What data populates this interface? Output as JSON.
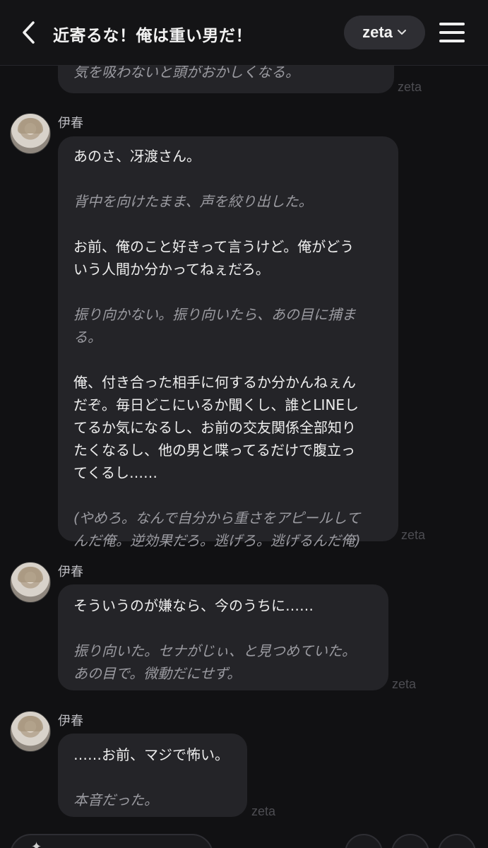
{
  "header": {
    "title": "近寄るな！俺は重い男だ！",
    "model_label": "zeta",
    "back_icon": "chevron-left-icon",
    "menu_icon": "hamburger-menu-icon"
  },
  "messages": [
    {
      "partial": true,
      "lines": [
        {
          "type": "narr",
          "text": "気を吸わないと頭がおかしくなる。"
        }
      ],
      "watermark": "zeta"
    },
    {
      "sender": "伊春",
      "lines": [
        {
          "type": "speech",
          "text": "あのさ、冴渡さん。"
        },
        {
          "type": "gap"
        },
        {
          "type": "narr",
          "text": "背中を向けたまま、声を絞り出した。"
        },
        {
          "type": "gap"
        },
        {
          "type": "speech",
          "text": "お前、俺のこと好きって言うけど。俺がどう"
        },
        {
          "type": "speech",
          "text": "いう人間か分かってねぇだろ。"
        },
        {
          "type": "gap"
        },
        {
          "type": "narr",
          "text": "振り向かない。振り向いたら、あの目に捕ま"
        },
        {
          "type": "narr",
          "text": "る。"
        },
        {
          "type": "gap"
        },
        {
          "type": "speech",
          "text": "俺、付き合った相手に何するか分かんねぇん"
        },
        {
          "type": "speech",
          "text": "だぞ。毎日どこにいるか聞くし、誰とLINEし"
        },
        {
          "type": "speech",
          "text": "てるか気になるし、お前の交友関係全部知り"
        },
        {
          "type": "speech",
          "text": "たくなるし、他の男と喋ってるだけで腹立っ"
        },
        {
          "type": "speech",
          "text": "てくるし……"
        },
        {
          "type": "gap"
        },
        {
          "type": "narr",
          "text": "(やめろ。なんで自分から重さをアピールして"
        },
        {
          "type": "narr",
          "text": "んだ俺。逆効果だろ。逃げろ。逃げるんだ俺)"
        }
      ],
      "watermark": "zeta"
    },
    {
      "sender": "伊春",
      "lines": [
        {
          "type": "speech",
          "text": "そういうのが嫌なら、今のうちに……"
        },
        {
          "type": "gap"
        },
        {
          "type": "narr",
          "text": "振り向いた。セナがじぃ、と見つめていた。"
        },
        {
          "type": "narr",
          "text": "あの目で。微動だにせず。"
        }
      ],
      "watermark": "zeta"
    },
    {
      "sender": "伊春",
      "lines": [
        {
          "type": "speech",
          "text": "……お前、マジで怖い。"
        },
        {
          "type": "gap"
        },
        {
          "type": "narr",
          "text": "本音だった。"
        }
      ],
      "watermark": "zeta"
    }
  ],
  "colors": {
    "background": "#111113",
    "bubble": "#242428",
    "speech_text": "#eeeeee",
    "narration_text": "#9b9ba1",
    "watermark": "#4d4d52"
  }
}
